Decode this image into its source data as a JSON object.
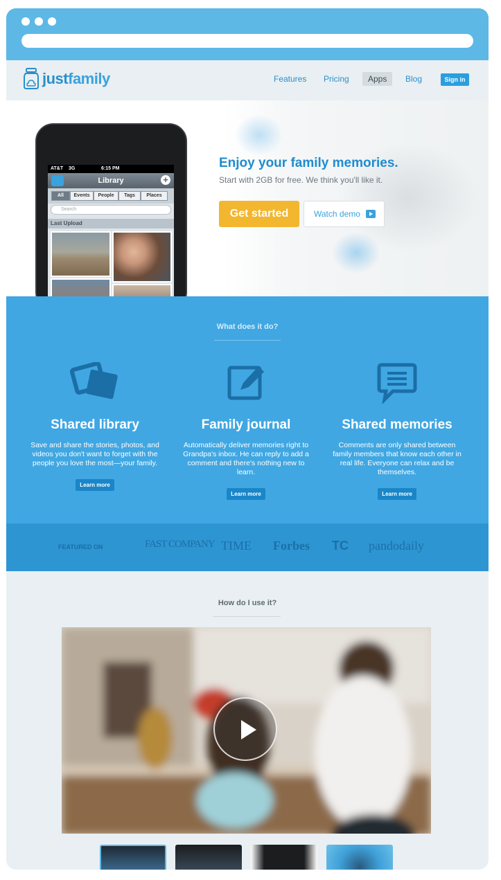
{
  "nav": {
    "logo": {
      "part1": "just",
      "part2": "family"
    },
    "links": [
      "Features",
      "Pricing",
      "Apps",
      "Blog"
    ],
    "active": "Apps",
    "signin": "Sign in"
  },
  "hero": {
    "title": "Enjoy your family memories.",
    "subtitle": "Start with 2GB for free. We think you'll like it.",
    "cta_primary": "Get started",
    "cta_secondary": "Watch demo"
  },
  "phone": {
    "carrier": "AT&T",
    "network": "3G",
    "time": "6:15 PM",
    "title": "Library",
    "segments": [
      "All",
      "Events",
      "People",
      "Tags",
      "Places"
    ],
    "search_placeholder": "Search",
    "section": "Last Upload"
  },
  "features": {
    "heading": "What does it do?",
    "items": [
      {
        "icon": "photos-icon",
        "title": "Shared library",
        "desc": "Save and share the stories, photos, and videos you don't want to forget with the people you love the most—your family.",
        "cta": "Learn more"
      },
      {
        "icon": "journal-edit-icon",
        "title": "Family journal",
        "desc": "Automatically deliver memories right to Grandpa's inbox. He can reply to add a comment and there's nothing new to learn.",
        "cta": "Learn more"
      },
      {
        "icon": "comment-icon",
        "title": "Shared memories",
        "desc": "Comments are only shared between family members that know each other in real life. Everyone can relax and be themselves.",
        "cta": "Learn more"
      }
    ]
  },
  "featured": {
    "label": "FEATURED ON",
    "outlets": [
      "FAST COMPANY",
      "TIME",
      "Forbes",
      "TC",
      "pandodaily"
    ]
  },
  "how": {
    "heading": "How do I use it?"
  },
  "colors": {
    "brand": "#3aa2dc",
    "blue_section": "#40a7e2",
    "cta": "#f2b62f"
  }
}
